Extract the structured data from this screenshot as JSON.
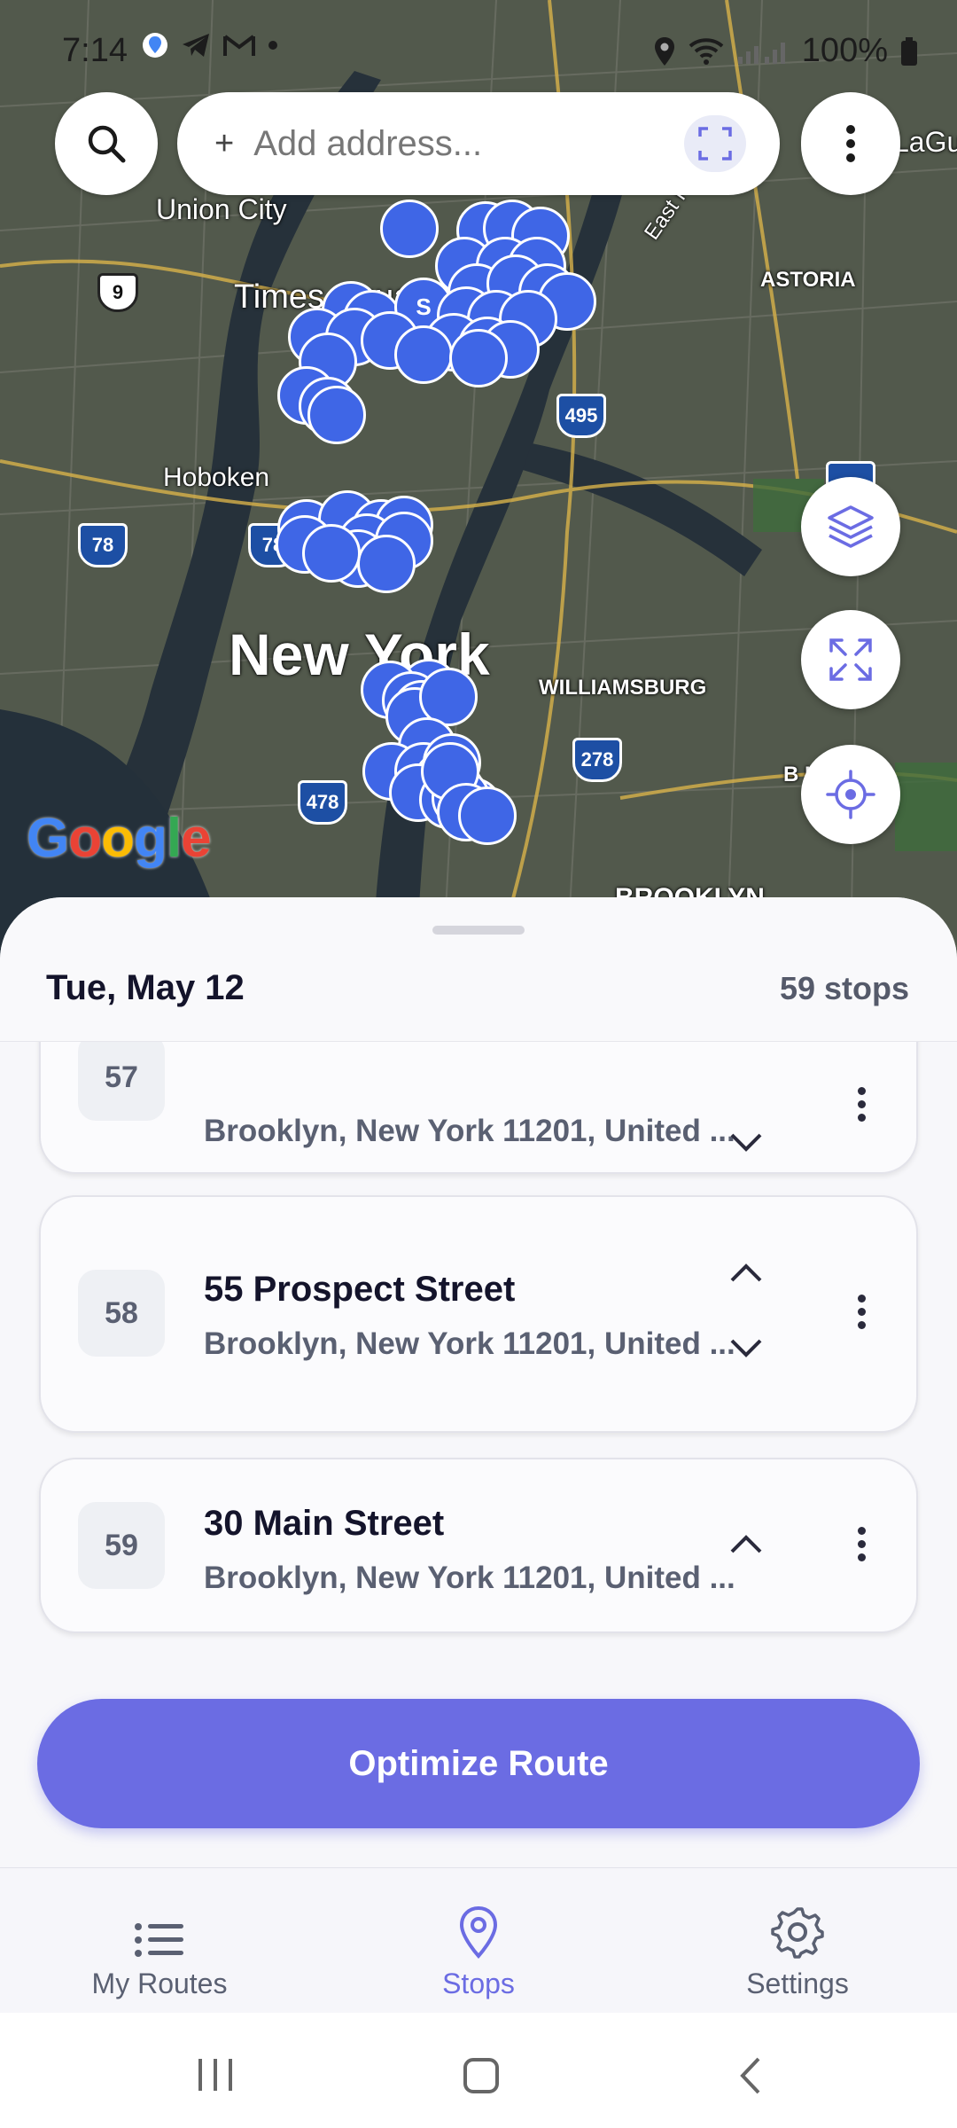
{
  "status_bar": {
    "time": "7:14",
    "battery": "100%"
  },
  "search": {
    "plus": "+",
    "placeholder": "Add address..."
  },
  "map": {
    "labels": {
      "union_city": "Union City",
      "times_square": "Times Square",
      "hoboken": "Hoboken",
      "new_york": "New York",
      "williamsburg": "WILLIAMSBURG",
      "astoria": "ASTORIA",
      "east_river": "East River",
      "brooklyn": "BROOKLYN",
      "laguardia": "LaGu",
      "bk_edge": "B      K"
    },
    "shields": {
      "r9": "9",
      "i495": "495",
      "i78a": "78",
      "i78b": "78",
      "i278": "278",
      "i478": "478"
    },
    "marker_label": "S",
    "google": "Google",
    "colors": {
      "marker": "#3f66e6",
      "accent": "#6b6ce3"
    }
  },
  "sheet": {
    "date": "Tue, May 12",
    "stops_count": "59 stops"
  },
  "stops": [
    {
      "number": "57",
      "street": "",
      "city": "Brooklyn, New York 11201, United ..."
    },
    {
      "number": "58",
      "street": "55 Prospect Street",
      "city": "Brooklyn, New York 11201, United ..."
    },
    {
      "number": "59",
      "street": "30 Main Street",
      "city": "Brooklyn, New York 11201, United ..."
    }
  ],
  "optimize_label": "Optimize Route",
  "nav": {
    "my_routes": "My Routes",
    "stops": "Stops",
    "settings": "Settings"
  }
}
